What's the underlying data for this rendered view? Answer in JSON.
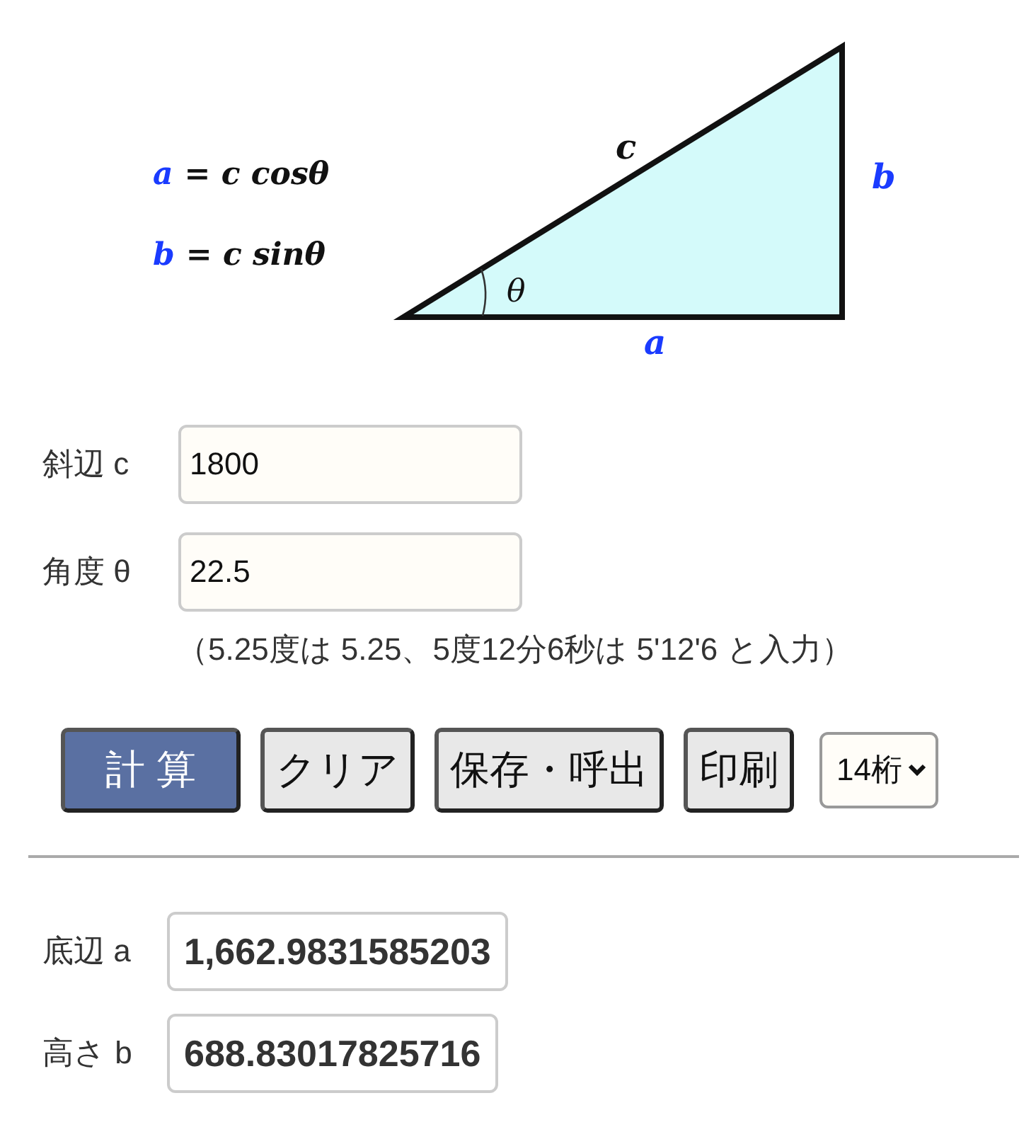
{
  "diagram": {
    "formulas": [
      {
        "variable": "a",
        "expression": "= c cosθ"
      },
      {
        "variable": "b",
        "expression": "= c sinθ"
      }
    ],
    "side_labels": {
      "hypotenuse": "c",
      "opposite": "b",
      "adjacent": "a",
      "angle": "θ"
    }
  },
  "inputs": [
    {
      "label": "斜辺 c",
      "value": "1800"
    },
    {
      "label": "角度 θ",
      "value": "22.5"
    }
  ],
  "note": "（5.25度は 5.25、5度12分6秒は 5'12'6 と入力）",
  "buttons": [
    {
      "label": "計 算",
      "kind": "primary"
    },
    {
      "label": "クリア",
      "kind": "default"
    },
    {
      "label": "保存・呼出",
      "kind": "default"
    },
    {
      "label": "印刷",
      "kind": "default"
    }
  ],
  "digits_select": {
    "value": "14桁"
  },
  "results": [
    {
      "label": "底辺 a",
      "value": "1,662.9831585203"
    },
    {
      "label": "高さ b",
      "value": "688.83017825716"
    }
  ]
}
